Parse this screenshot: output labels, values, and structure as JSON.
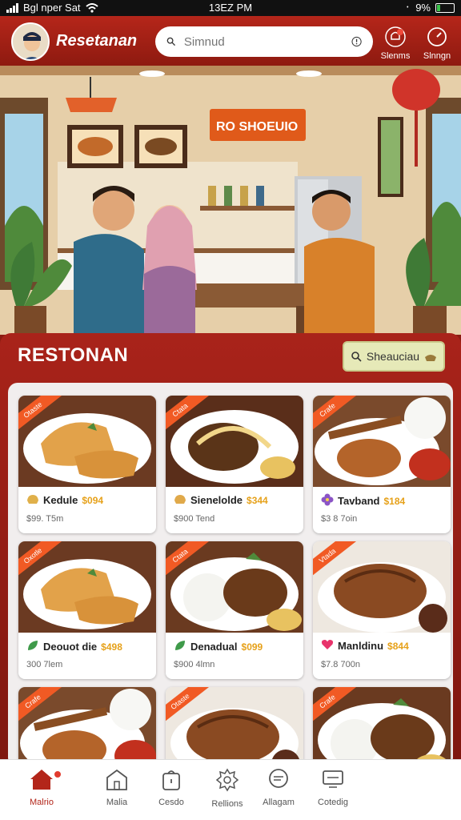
{
  "status_bar": {
    "carrier": "Bgl nper Sat",
    "time": "13EZ PM",
    "battery": "9%"
  },
  "header": {
    "title": "Resetanan",
    "search_placeholder": "Simnud",
    "actions": [
      {
        "label": "Slenms",
        "icon": "bell-icon"
      },
      {
        "label": "Slnngn",
        "icon": "timer-icon"
      }
    ]
  },
  "hero": {
    "sign": "RO SHOEUIO"
  },
  "section": {
    "title": "RESTONAN",
    "schedule_label": "Sheauciau"
  },
  "dishes": [
    {
      "ribbon": "Otaste",
      "name": "Kedule",
      "price": "$094",
      "meta": "$99.  T5m",
      "icon": "bread-icon",
      "icon_color": "#e0b04a",
      "photo": "bread"
    },
    {
      "ribbon": "Ctata",
      "name": "Sienelolde",
      "price": "$344",
      "meta": "$900  Tend",
      "icon": "bread-icon",
      "icon_color": "#e0a94a",
      "photo": "noodle"
    },
    {
      "ribbon": "Crafe",
      "name": "Tavband",
      "price": "$184",
      "meta": "$3 8  7oin",
      "icon": "flower-icon",
      "icon_color": "#8b55c5",
      "photo": "chicken-sticks"
    },
    {
      "ribbon": "Oxotle",
      "name": "Deouot die",
      "price": "$498",
      "meta": "300  7lem",
      "icon": "leaf-icon",
      "icon_color": "#3f9a4a",
      "photo": "bread"
    },
    {
      "ribbon": "Ctata",
      "name": "Denadual",
      "price": "$099",
      "meta": "$900  4lmn",
      "icon": "leaf-icon",
      "icon_color": "#3f9a4a",
      "photo": "rice-noodle"
    },
    {
      "ribbon": "Vtada",
      "name": "Manldinu",
      "price": "$844",
      "meta": "$7.8  700n",
      "icon": "heart-icon",
      "icon_color": "#e8336b",
      "photo": "roast"
    },
    {
      "ribbon": "Crafe",
      "name": "",
      "price": "",
      "meta": "",
      "icon": "",
      "icon_color": "#3f9a4a",
      "photo": "chicken-sticks"
    },
    {
      "ribbon": "Otaste",
      "name": "",
      "price": "",
      "meta": "",
      "icon": "",
      "icon_color": "#3f9a4a",
      "photo": "roast"
    },
    {
      "ribbon": "Crafe",
      "name": "",
      "price": "",
      "meta": "",
      "icon": "",
      "icon_color": "#3f9a4a",
      "photo": "rice-noodle"
    }
  ],
  "bottom_nav": [
    {
      "label": "Malrio",
      "icon": "home-icon",
      "active": true
    },
    {
      "label": "Malia",
      "icon": "building-icon",
      "active": false
    },
    {
      "label": "Cesdo",
      "icon": "bag-icon",
      "active": false
    },
    {
      "label": "Rellions",
      "icon": "gear-icon",
      "active": false
    },
    {
      "label": "Allagam",
      "icon": "chat-icon",
      "active": false
    },
    {
      "label": "Cotedig",
      "icon": "screen-icon",
      "active": false
    }
  ],
  "colors": {
    "brand": "#b3261a",
    "accent": "#f15a24",
    "price": "#e6a11a"
  }
}
